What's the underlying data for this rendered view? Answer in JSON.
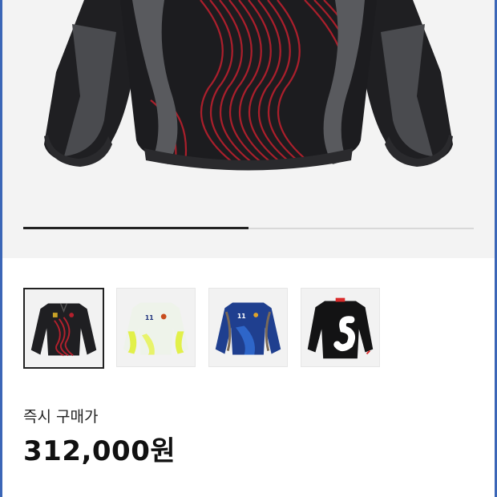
{
  "product": {
    "image_alt": "jacket",
    "gallery_progress": 0.5,
    "thumbnails": [
      {
        "variant": "black-red",
        "selected": true
      },
      {
        "variant": "white-yellow",
        "selected": false
      },
      {
        "variant": "blue",
        "selected": false
      },
      {
        "variant": "black-s-logo",
        "selected": false
      }
    ]
  },
  "price": {
    "label": "즉시 구매가",
    "value": "312,000원"
  },
  "colors": {
    "frame_accent": "#3b66b7",
    "jacket_black": "#1f1f22",
    "jacket_gray": "#595a5e",
    "pattern_red": "#b3202d"
  }
}
